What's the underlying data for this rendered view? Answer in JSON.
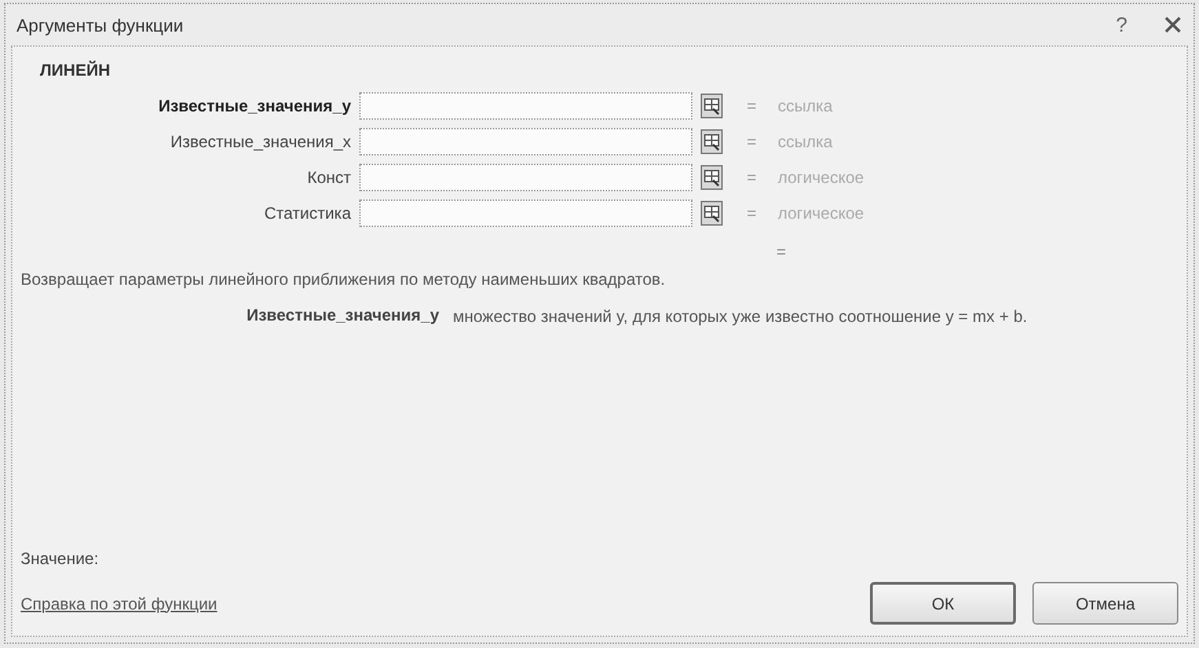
{
  "window": {
    "title": "Аргументы функции",
    "help": "?"
  },
  "function_name": "ЛИНЕЙН",
  "arguments": [
    {
      "label": "Известные_значения_y",
      "bold": true,
      "eq": "=",
      "result": "ссылка"
    },
    {
      "label": "Известные_значения_x",
      "bold": false,
      "eq": "=",
      "result": "ссылка"
    },
    {
      "label": "Конст",
      "bold": false,
      "eq": "=",
      "result": "логическое"
    },
    {
      "label": "Статистика",
      "bold": false,
      "eq": "=",
      "result": "логическое"
    }
  ],
  "formula_result": "=",
  "description": "Возвращает параметры линейного приближения по методу наименьших квадратов.",
  "argument_help": {
    "name": "Известные_значения_y",
    "text": "множество значений y, для которых уже известно соотношение y = mx + b."
  },
  "value_label": "Значение:",
  "help_link": "Справка по этой функции",
  "buttons": [
    {
      "label": "ОК",
      "default": true
    },
    {
      "label": "Отмена",
      "default": false
    }
  ]
}
